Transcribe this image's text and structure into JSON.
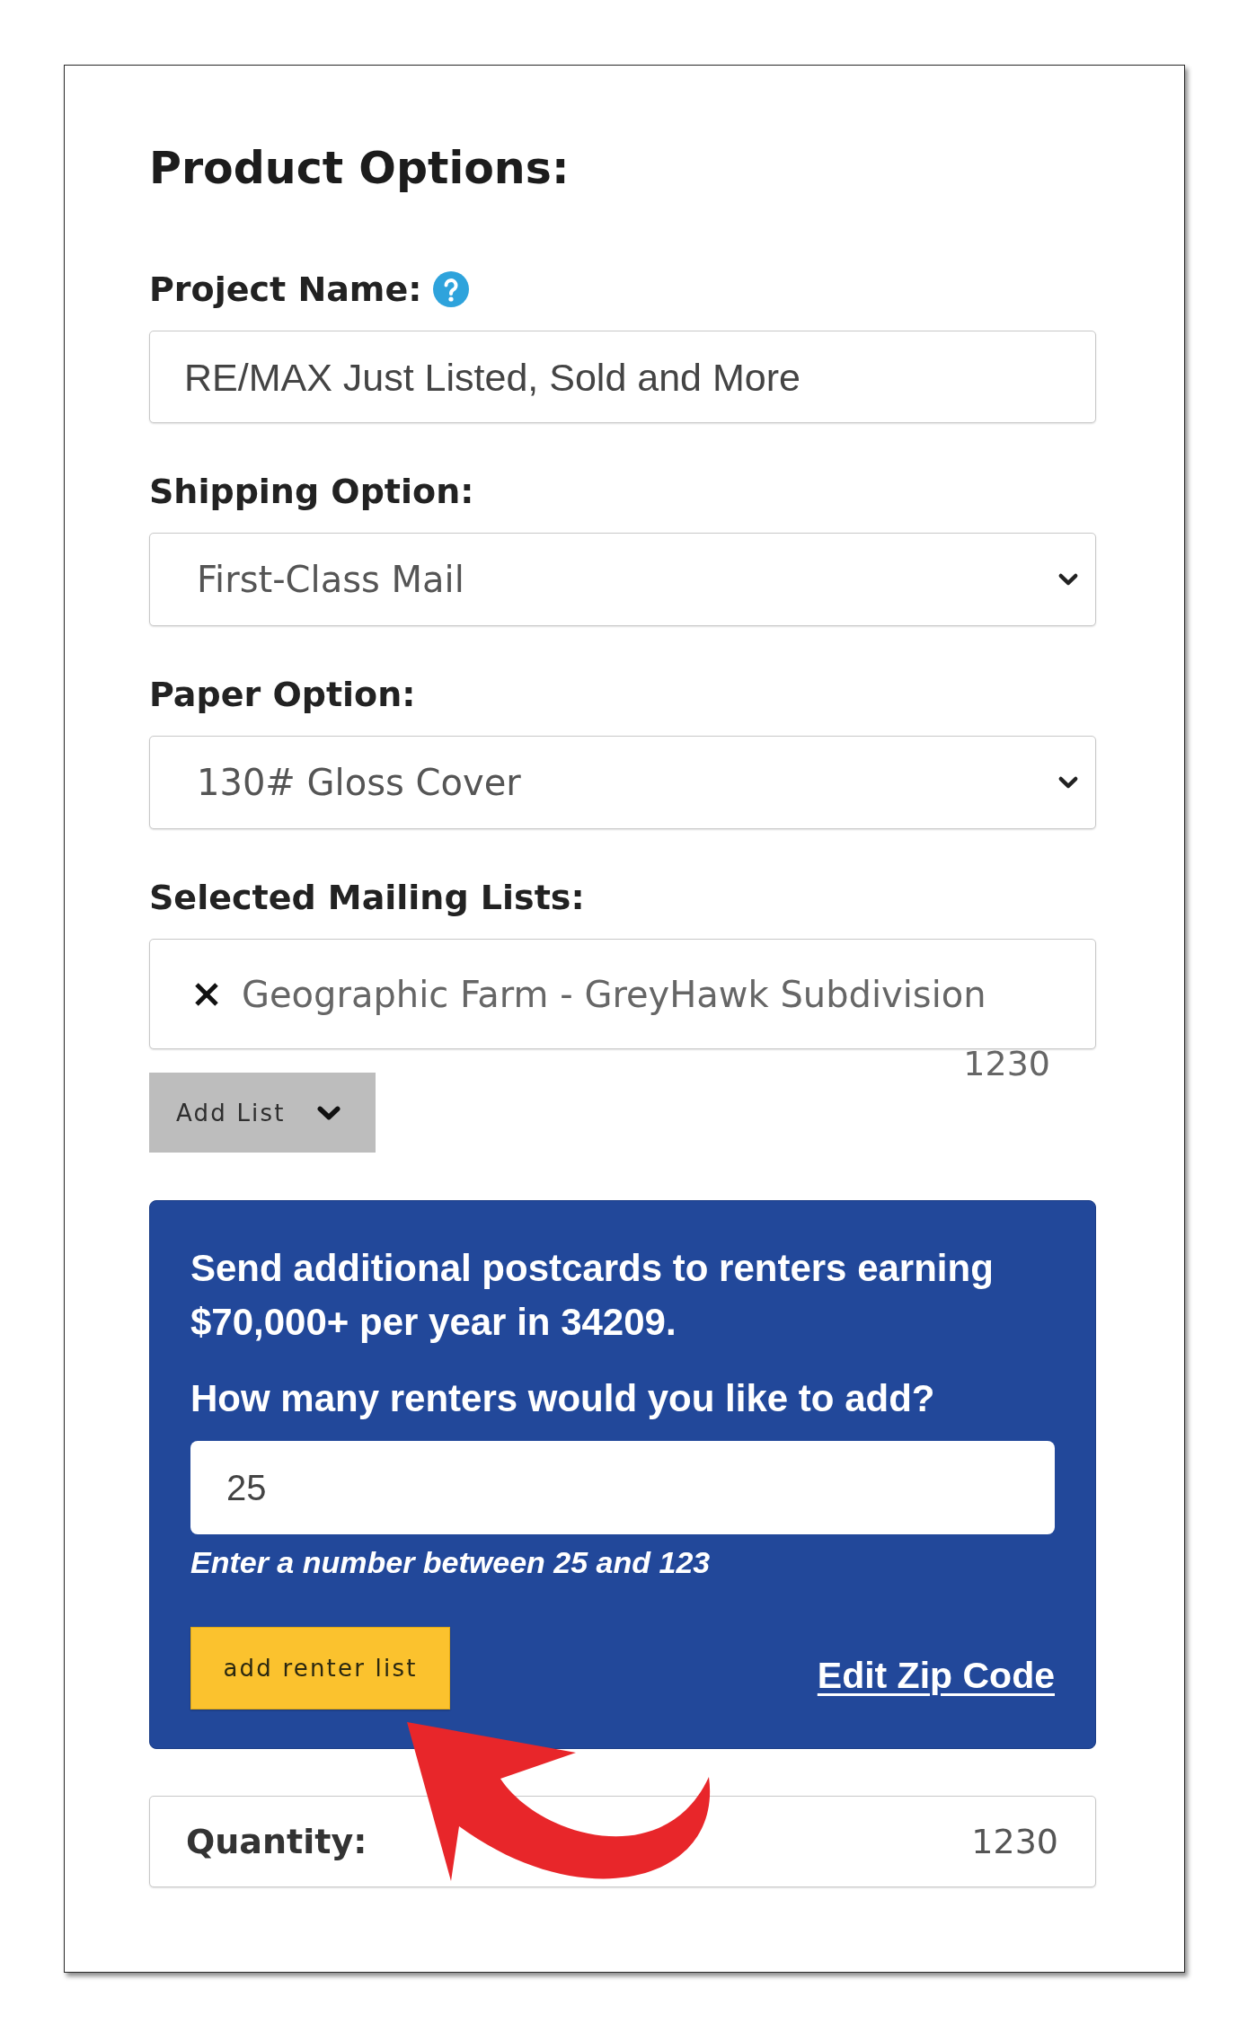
{
  "title": "Product Options:",
  "fields": [
    {
      "kind": "text",
      "label": "Project Name:",
      "help": true,
      "value": "RE/MAX Just Listed, Sold and More"
    },
    {
      "kind": "select",
      "label": "Shipping Option:",
      "help": false,
      "value": "First-Class Mail"
    },
    {
      "kind": "select",
      "label": "Paper Option:",
      "help": false,
      "value": "130# Gloss Cover"
    },
    {
      "kind": "tags",
      "label": "Selected Mailing Lists:",
      "help": false,
      "tags": [
        {
          "name": "Geographic Farm - GreyHawk Subdivision",
          "count": "1230"
        }
      ]
    }
  ],
  "add_list_button": "Add List",
  "renter_offer": {
    "message": "Send additional postcards to renters earning $70,000+ per year in 34209.",
    "question": "How many renters would you like to add?",
    "value": "25",
    "hint": "Enter a number between 25 and 123",
    "button": "add renter list",
    "link": "Edit Zip Code"
  },
  "quantity": {
    "label": "Quantity:",
    "value": "1230"
  }
}
